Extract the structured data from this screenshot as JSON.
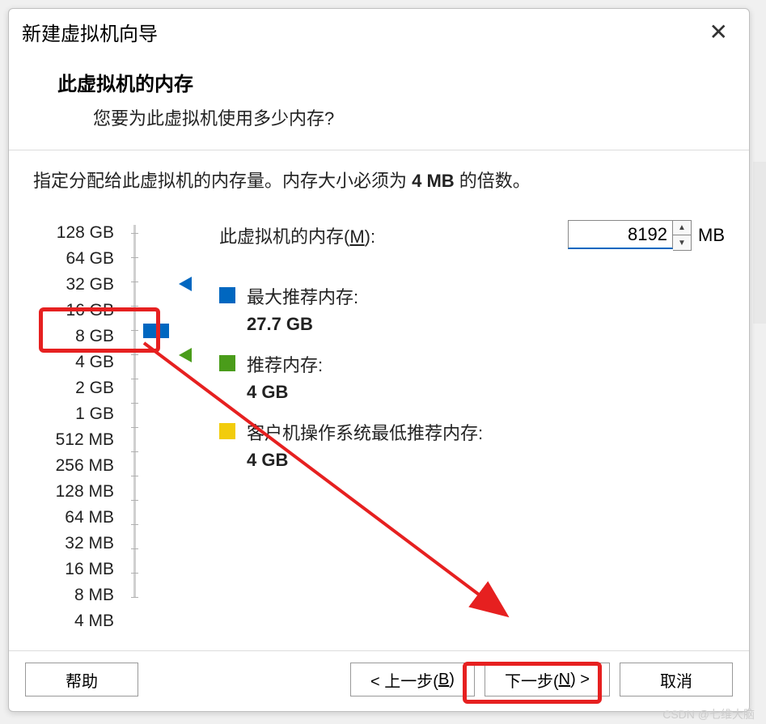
{
  "titlebar": {
    "title": "新建虚拟机向导"
  },
  "header": {
    "title": "此虚拟机的内存",
    "subtitle": "您要为此虚拟机使用多少内存?"
  },
  "instruction": {
    "pre": "指定分配给此虚拟机的内存量。内存大小必须为 ",
    "bold": "4 MB",
    "post": " 的倍数。"
  },
  "memory": {
    "label_pre": "此虚拟机的内存(",
    "label_key": "M",
    "label_post": "):",
    "value": "8192",
    "unit": "MB",
    "ticks": [
      "128 GB",
      "64 GB",
      "32 GB",
      "16 GB",
      "8 GB",
      "4 GB",
      "2 GB",
      "1 GB",
      "512 MB",
      "256 MB",
      "128 MB",
      "64 MB",
      "32 MB",
      "16 MB",
      "8 MB",
      "4 MB"
    ]
  },
  "legend": {
    "max": {
      "label": "最大推荐内存:",
      "value": "27.7 GB"
    },
    "rec": {
      "label": "推荐内存:",
      "value": "4 GB"
    },
    "min": {
      "label": "客户机操作系统最低推荐内存:",
      "value": "4 GB"
    }
  },
  "buttons": {
    "help": "帮助",
    "back_pre": "< 上一步(",
    "back_key": "B",
    "back_post": ")",
    "next_pre": "下一步(",
    "next_key": "N",
    "next_post": ") >",
    "cancel": "取消"
  },
  "watermark": "CSDN @七维大脑"
}
